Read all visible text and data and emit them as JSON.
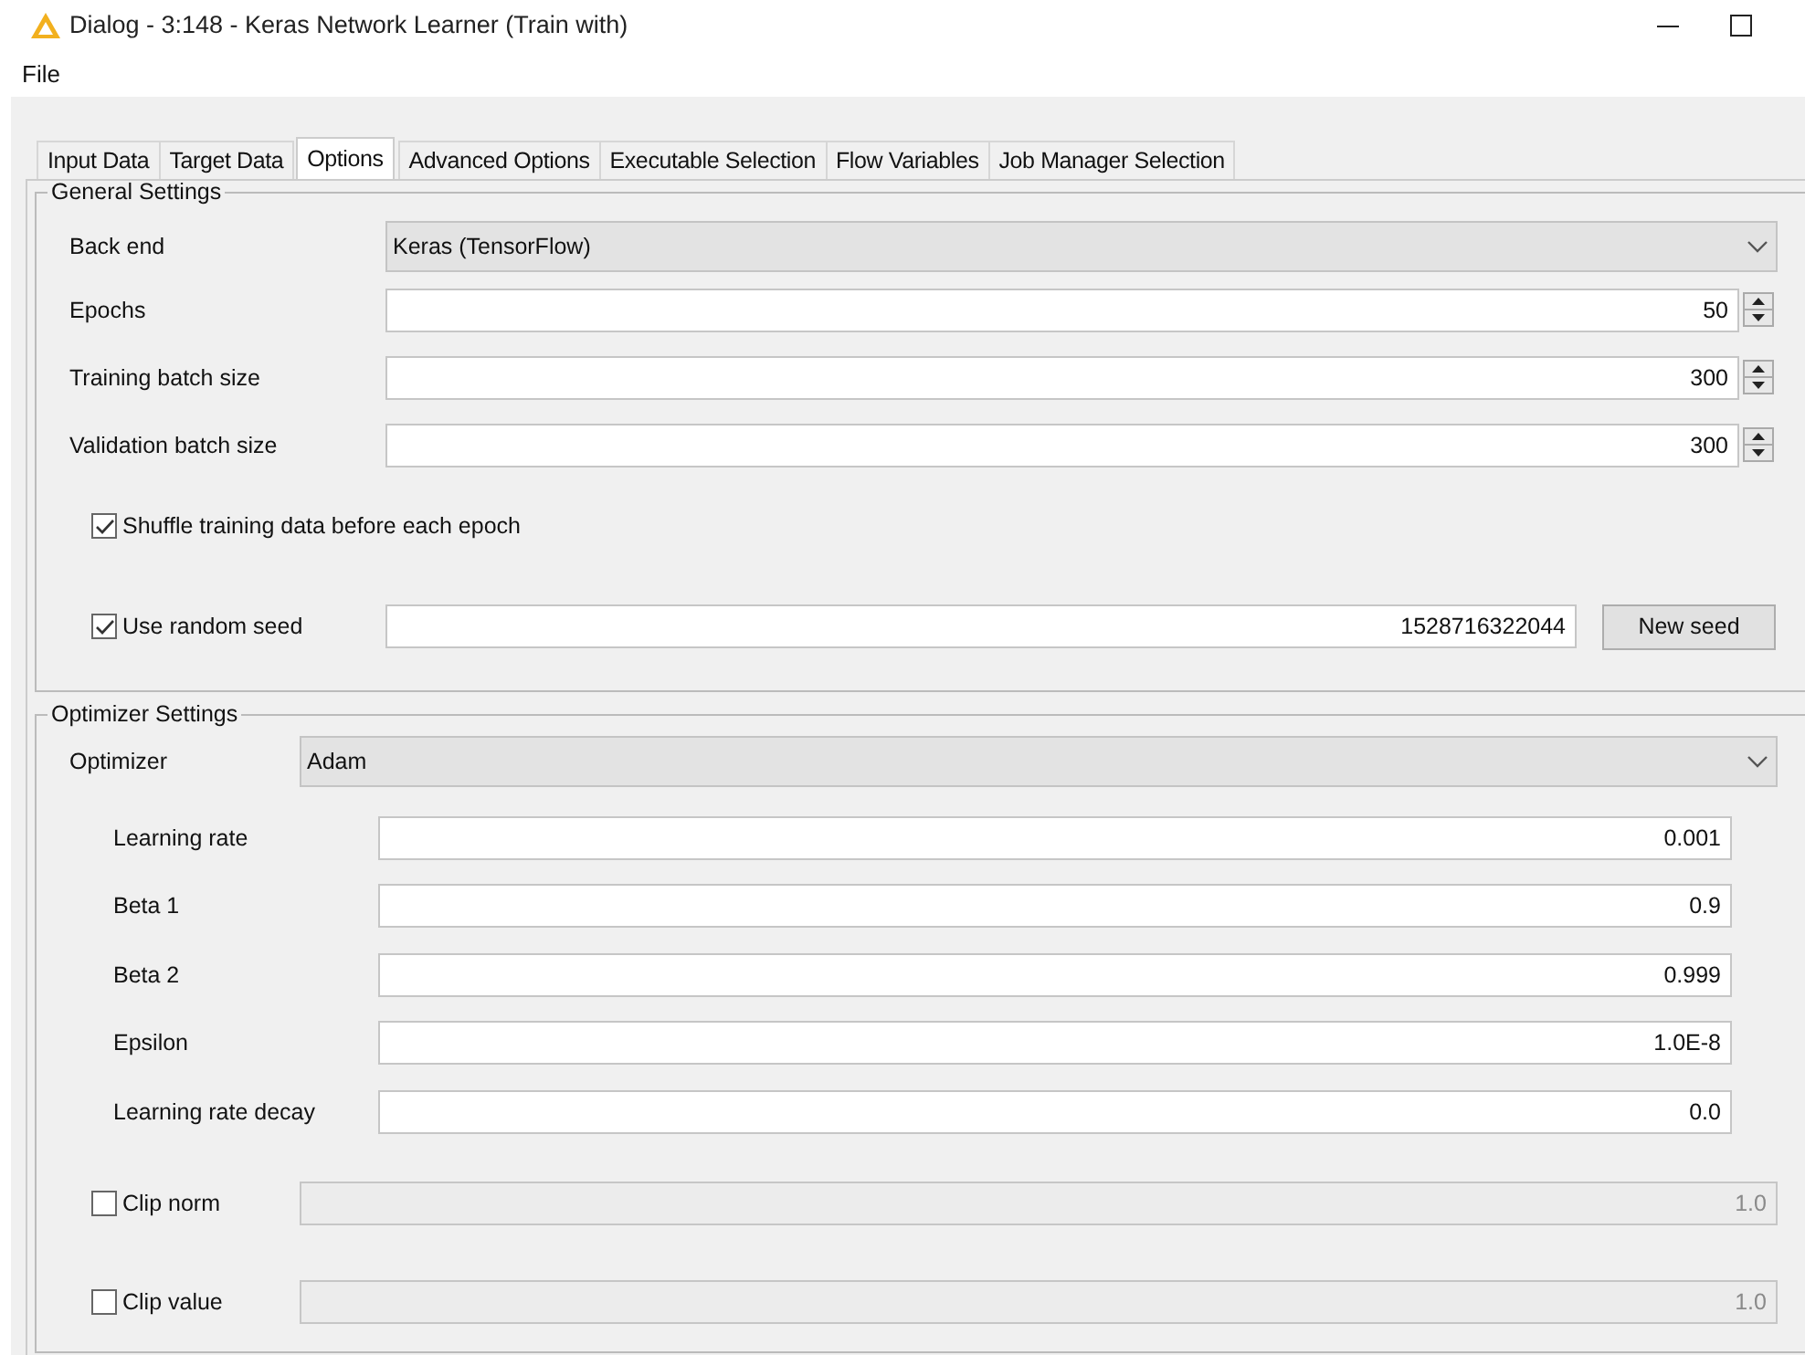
{
  "window": {
    "title": "Dialog - 3:148 - Keras Network Learner (Train with)"
  },
  "menu": [
    "File"
  ],
  "tabs": [
    {
      "label": "Input Data",
      "selected": false
    },
    {
      "label": "Target Data",
      "selected": false
    },
    {
      "label": "Options",
      "selected": true
    },
    {
      "label": "Advanced Options",
      "selected": false
    },
    {
      "label": "Executable Selection",
      "selected": false
    },
    {
      "label": "Flow Variables",
      "selected": false
    },
    {
      "label": "Job Manager Selection",
      "selected": false
    }
  ],
  "general": {
    "title": "General Settings",
    "backend": {
      "label": "Back end",
      "value": "Keras (TensorFlow)"
    },
    "spinners": [
      {
        "label": "Epochs",
        "value": "50"
      },
      {
        "label": "Training batch size",
        "value": "300"
      },
      {
        "label": "Validation batch size",
        "value": "300"
      }
    ],
    "shuffle": {
      "label": "Shuffle training data before each epoch",
      "checked": true
    },
    "seed": {
      "label": "Use random seed",
      "checked": true,
      "value": "1528716322044",
      "button": "New seed"
    }
  },
  "optimizer": {
    "title": "Optimizer Settings",
    "select": {
      "label": "Optimizer",
      "value": "Adam"
    },
    "params": [
      {
        "label": "Learning rate",
        "value": "0.001"
      },
      {
        "label": "Beta 1",
        "value": "0.9"
      },
      {
        "label": "Beta 2",
        "value": "0.999"
      },
      {
        "label": "Epsilon",
        "value": "1.0E-8"
      },
      {
        "label": "Learning rate decay",
        "value": "0.0"
      }
    ],
    "clips": [
      {
        "label": "Clip norm",
        "checked": false,
        "disabled": true,
        "value": "1.0"
      },
      {
        "label": "Clip value",
        "checked": false,
        "disabled": true,
        "value": "1.0"
      }
    ]
  }
}
